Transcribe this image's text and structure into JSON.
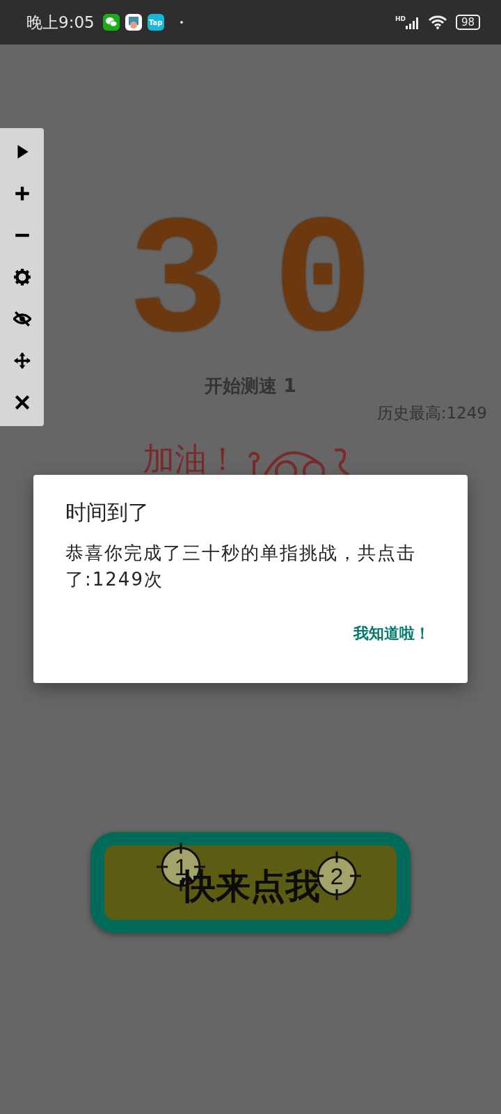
{
  "status_bar": {
    "time": "晚上9:05",
    "app_icons": [
      {
        "kind": "chat"
      },
      {
        "kind": "app"
      },
      {
        "kind": "tap",
        "label": "Tap"
      }
    ],
    "network": "HD",
    "battery": "98"
  },
  "toolbar": {
    "tools": [
      {
        "kind": "play"
      },
      {
        "kind": "plus"
      },
      {
        "kind": "minus"
      },
      {
        "kind": "settings"
      },
      {
        "kind": "hide"
      },
      {
        "kind": "move"
      },
      {
        "kind": "close"
      }
    ]
  },
  "timer": {
    "digits": [
      "3",
      "0"
    ]
  },
  "status_text": "开始测速 1",
  "best_score": "历史最高:1249",
  "cheer": "加油！",
  "dialog": {
    "title": "时间到了",
    "message": "恭喜你完成了三十秒的单指挑战，共点击了:1249次",
    "button": "我知道啦！"
  },
  "tap_button": {
    "label": "快来点我",
    "markers": [
      {
        "label": "1"
      },
      {
        "label": "2"
      }
    ]
  }
}
